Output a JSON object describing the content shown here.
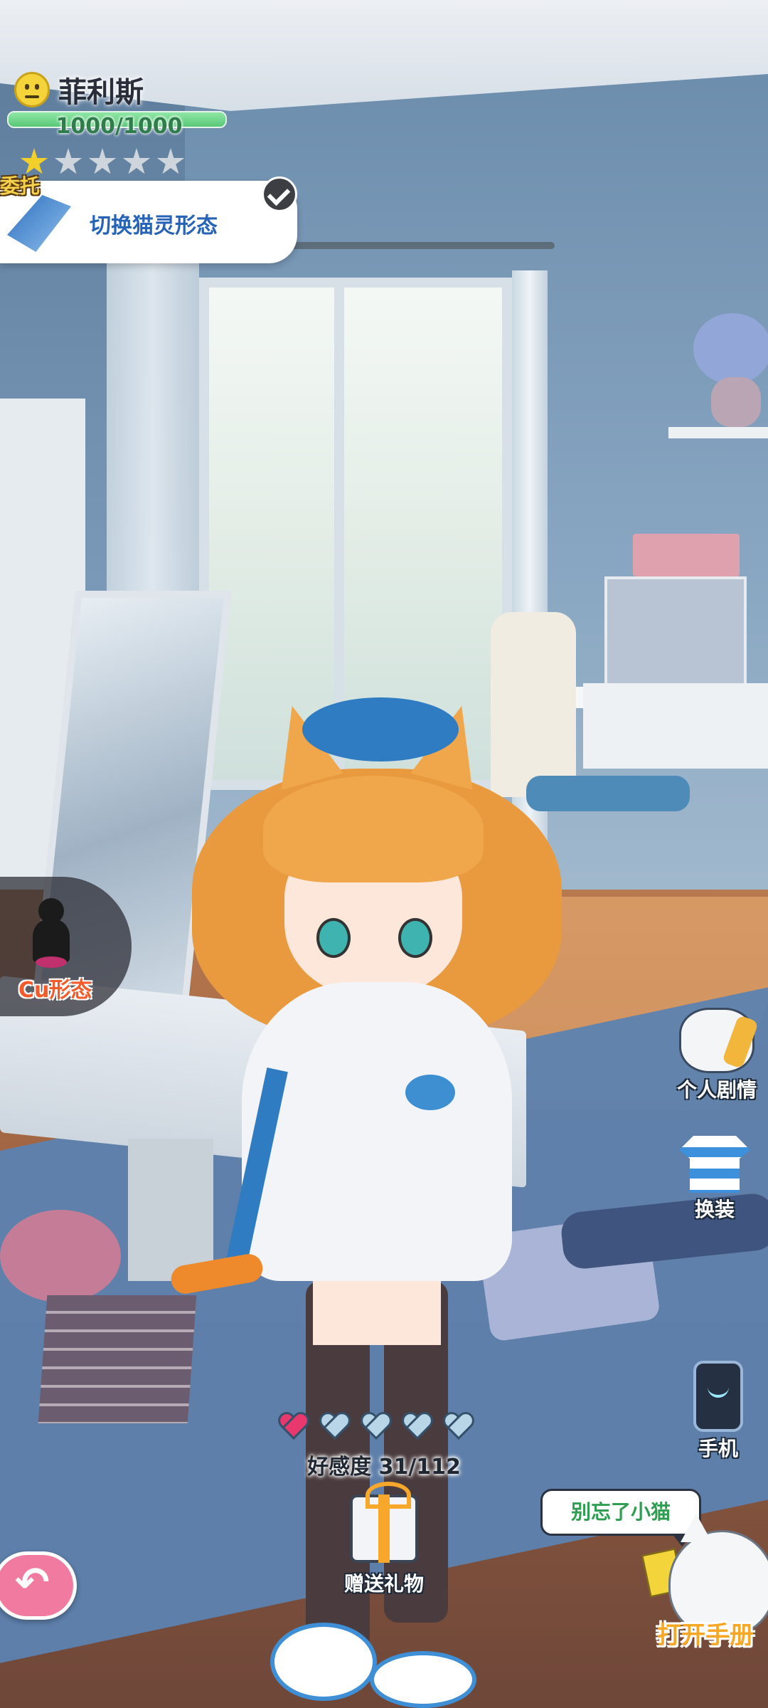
{
  "character": {
    "name": "菲利斯",
    "hp_text": "1000/1000",
    "hp_fraction": 1.0,
    "star_rating": 1,
    "star_max": 5
  },
  "commission": {
    "tag": "委托",
    "label": "切换猫灵形态",
    "status_icon": "check-icon",
    "icon": "flashlight-icon"
  },
  "form": {
    "label": "Cu形态",
    "icon": "silhouette-icon"
  },
  "side_menu": {
    "story": "个人剧情",
    "outfit": "换装",
    "phone": "手机"
  },
  "affinity": {
    "label": "好感度 31/112",
    "hearts_filled": 1,
    "hearts_total": 5,
    "heart_colors": {
      "filled": "#e8386e",
      "empty": "#b9d6e8"
    }
  },
  "gift": {
    "label": "赠送礼物"
  },
  "guide": {
    "speech": "别忘了小猫",
    "button": "打开手册"
  },
  "colors": {
    "hp_green": "#58c877",
    "accent_blue": "#2763b7",
    "form_orange": "#f45b2a",
    "manual_orange": "#f7a726",
    "back_pink": "#f07aa0"
  }
}
